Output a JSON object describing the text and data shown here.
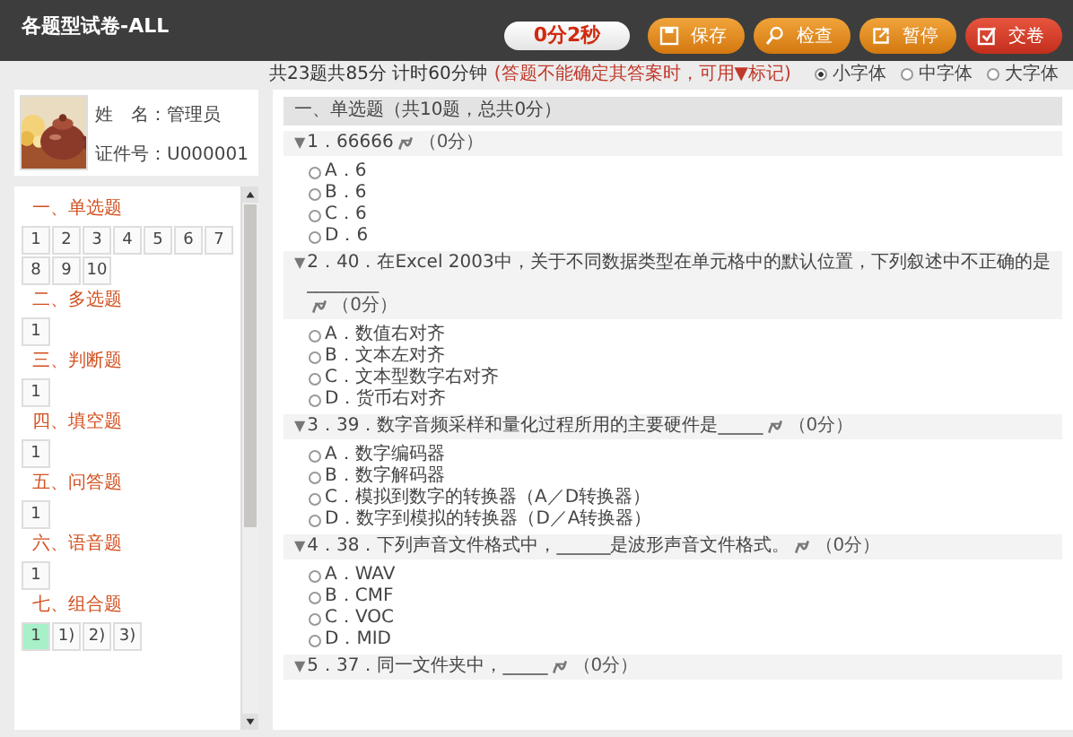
{
  "window": {
    "title": "各题型试卷-ALL"
  },
  "timer": "0分2秒",
  "toolbar": [
    {
      "label": "保存",
      "kind": "save"
    },
    {
      "label": "检查",
      "kind": "check"
    },
    {
      "label": "暂停",
      "kind": "pause"
    },
    {
      "label": "交卷",
      "kind": "submit"
    }
  ],
  "summary": {
    "text": "共23题共85分 计时60分钟",
    "hint": "(答题不能确定其答案时，可用▼标记)"
  },
  "font_sizes": [
    {
      "label": "小字体",
      "selected": true
    },
    {
      "label": "中字体",
      "selected": false
    },
    {
      "label": "大字体",
      "selected": false
    }
  ],
  "profile": {
    "photo": {
      "kind": "picture"
    },
    "fields": [
      "姓　名：管理员",
      "证件号：U000001"
    ]
  },
  "navigator": {
    "sections": [
      {
        "title": "一、单选题",
        "items": [
          {
            "label": "1",
            "current": false
          },
          {
            "label": "2",
            "current": false
          },
          {
            "label": "3",
            "current": false
          },
          {
            "label": "4",
            "current": false
          },
          {
            "label": "5",
            "current": false
          },
          {
            "label": "6",
            "current": false
          },
          {
            "label": "7",
            "current": false
          },
          {
            "label": "8",
            "current": false
          },
          {
            "label": "9",
            "current": false
          },
          {
            "label": "10",
            "current": false
          }
        ]
      },
      {
        "title": "二、多选题",
        "items": [
          {
            "label": "1",
            "current": false
          }
        ]
      },
      {
        "title": "三、判断题",
        "items": [
          {
            "label": "1",
            "current": false
          }
        ]
      },
      {
        "title": "四、填空题",
        "items": [
          {
            "label": "1",
            "current": false
          }
        ]
      },
      {
        "title": "五、问答题",
        "items": [
          {
            "label": "1",
            "current": false
          }
        ]
      },
      {
        "title": "六、语音题",
        "items": [
          {
            "label": "1",
            "current": false
          }
        ]
      },
      {
        "title": "七、组合题",
        "items": [
          {
            "label": "1",
            "current": true
          },
          {
            "label": "1)",
            "current": false
          },
          {
            "label": "2)",
            "current": false
          },
          {
            "label": "3)",
            "current": false
          }
        ]
      }
    ]
  },
  "paper": {
    "section_title": "一、单选题（共10题，总共0分）",
    "questions": [
      {
        "flag": "▼",
        "title": "1．66666",
        "score": "（0分）",
        "options": [
          {
            "label": "A．6",
            "selected": false
          },
          {
            "label": "B．6",
            "selected": false
          },
          {
            "label": "C．6",
            "selected": false
          },
          {
            "label": "D．6",
            "selected": false
          }
        ]
      },
      {
        "flag": "▼",
        "title": "2．40．在Excel 2003中，关于不同数据类型在单元格中的默认位置，下列叙述中不正确的是________",
        "score": "（0分）",
        "options": [
          {
            "label": "A．数值右对齐",
            "selected": false
          },
          {
            "label": "B．文本左对齐",
            "selected": false
          },
          {
            "label": "C．文本型数字右对齐",
            "selected": false
          },
          {
            "label": "D．货币右对齐",
            "selected": false
          }
        ]
      },
      {
        "flag": "▼",
        "title": "3．39．数字音频采样和量化过程所用的主要硬件是_____",
        "score": "（0分）",
        "options": [
          {
            "label": "A．数字编码器",
            "selected": false
          },
          {
            "label": "B．数字解码器",
            "selected": false
          },
          {
            "label": "C．模拟到数字的转换器（A／D转换器）",
            "selected": false
          },
          {
            "label": "D．数字到模拟的转换器（D／A转换器）",
            "selected": false
          }
        ]
      },
      {
        "flag": "▼",
        "title": "4．38．下列声音文件格式中，______是波形声音文件格式。",
        "score": "（0分）",
        "options": [
          {
            "label": "A．WAV",
            "selected": false
          },
          {
            "label": "B．CMF",
            "selected": false
          },
          {
            "label": "C．VOC",
            "selected": false
          },
          {
            "label": "D．MID",
            "selected": false
          }
        ]
      },
      {
        "flag": "▼",
        "title": "5．37．同一文件夹中，_____",
        "score": "（0分）"
      }
    ]
  }
}
